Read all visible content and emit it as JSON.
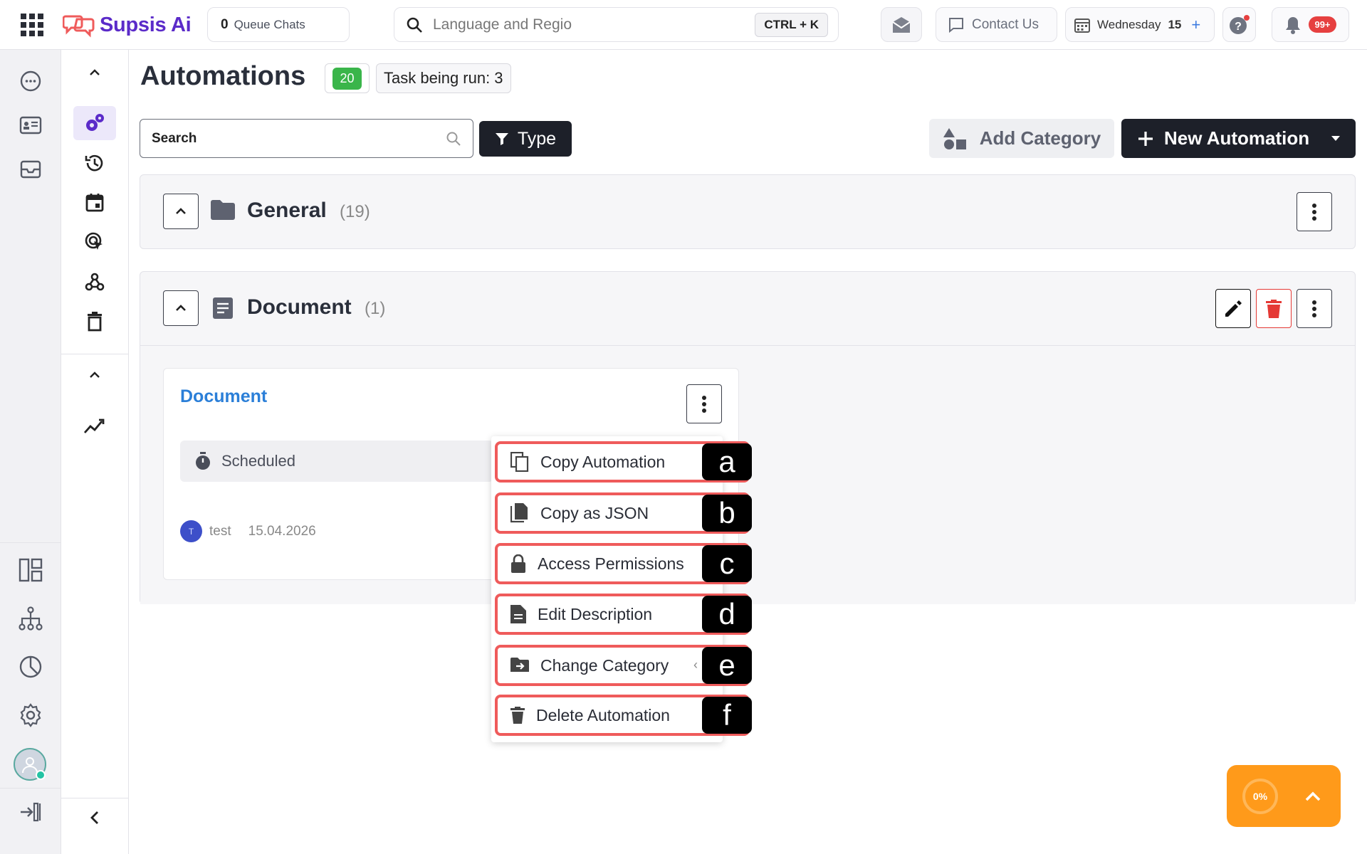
{
  "app": {
    "name_main": "Supsis",
    "name_ai": "Ai"
  },
  "topbar": {
    "queue_count": "0",
    "queue_label": "Queue Chats",
    "search_placeholder": "Language and Regio",
    "shortcut": "CTRL + K",
    "contact": "Contact Us",
    "day": "Wednesday",
    "date_num": "15",
    "notifications": "99+"
  },
  "page": {
    "title": "Automations",
    "count": "20",
    "task_running": "Task being run: 3",
    "search_placeholder": "Search",
    "type_label": "Type",
    "add_category": "Add Category",
    "new_automation": "New Automation"
  },
  "sections": {
    "general": {
      "title": "General",
      "count": "(19)"
    },
    "document": {
      "title": "Document",
      "count": "(1)"
    }
  },
  "card": {
    "title": "Document",
    "status": "Scheduled",
    "user_initial": "T",
    "user": "test",
    "date": "15.04.2026"
  },
  "menu": {
    "items": [
      {
        "label": "Copy Automation",
        "tag": "a",
        "icon": "copy-icon"
      },
      {
        "label": "Copy as JSON",
        "tag": "b",
        "icon": "file-copy-icon"
      },
      {
        "label": "Access Permissions",
        "tag": "c",
        "icon": "lock-icon"
      },
      {
        "label": "Edit Description",
        "tag": "d",
        "icon": "document-icon"
      },
      {
        "label": "Change Category",
        "tag": "e",
        "icon": "folder-move-icon"
      },
      {
        "label": "Delete Automation",
        "tag": "f",
        "icon": "trash-icon"
      }
    ]
  },
  "progress": {
    "percent": "0%"
  },
  "colors": {
    "brand": "#5b2bc9",
    "accent_orange": "#ff9a1a",
    "highlight": "#ef5b5b",
    "green": "#3ab54a"
  }
}
